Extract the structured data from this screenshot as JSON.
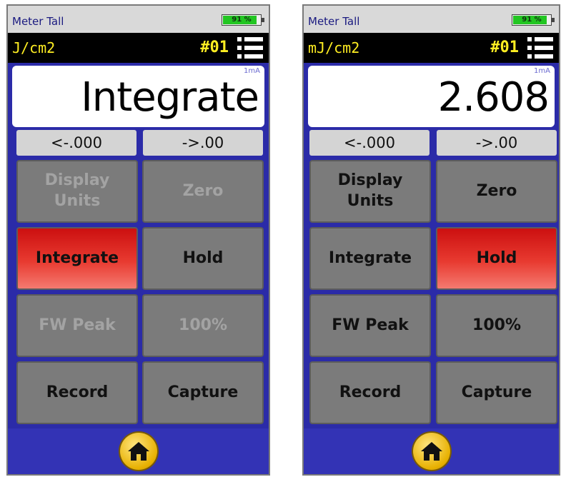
{
  "colors": {
    "panel_bg": "#2b2ba8",
    "accent_yellow": "#ffee22",
    "active_red": "#e83a30",
    "battery_green": "#22c622",
    "button_gray": "#7b7b7b"
  },
  "screens": [
    {
      "status_title": "Meter Tall",
      "battery": "91 %",
      "battery_level": 0.91,
      "units": "J/cm2",
      "channel": "#01",
      "range": "1mA",
      "reading": "Integrate",
      "dec_left": "<-.000",
      "dec_right": "->.00",
      "buttons": {
        "display_units": {
          "line1": "Display",
          "line2": "Units",
          "state": "disabled"
        },
        "zero": {
          "label": "Zero",
          "state": "disabled"
        },
        "integrate": {
          "label": "Integrate",
          "state": "active"
        },
        "hold": {
          "label": "Hold",
          "state": "normal"
        },
        "fw_peak": {
          "label": "FW Peak",
          "state": "disabled"
        },
        "percent": {
          "label": "100%",
          "state": "disabled"
        },
        "record": {
          "label": "Record",
          "state": "normal"
        },
        "capture": {
          "label": "Capture",
          "state": "normal"
        }
      },
      "home_icon": "home-icon"
    },
    {
      "status_title": "Meter Tall",
      "battery": "91 %",
      "battery_level": 0.91,
      "units": "mJ/cm2",
      "channel": "#01",
      "range": "1mA",
      "reading": "2.608",
      "dec_left": "<-.000",
      "dec_right": "->.00",
      "buttons": {
        "display_units": {
          "line1": "Display",
          "line2": "Units",
          "state": "normal"
        },
        "zero": {
          "label": "Zero",
          "state": "normal"
        },
        "integrate": {
          "label": "Integrate",
          "state": "normal"
        },
        "hold": {
          "label": "Hold",
          "state": "active"
        },
        "fw_peak": {
          "label": "FW Peak",
          "state": "normal"
        },
        "percent": {
          "label": "100%",
          "state": "normal"
        },
        "record": {
          "label": "Record",
          "state": "normal"
        },
        "capture": {
          "label": "Capture",
          "state": "normal"
        }
      },
      "home_icon": "home-icon"
    }
  ]
}
